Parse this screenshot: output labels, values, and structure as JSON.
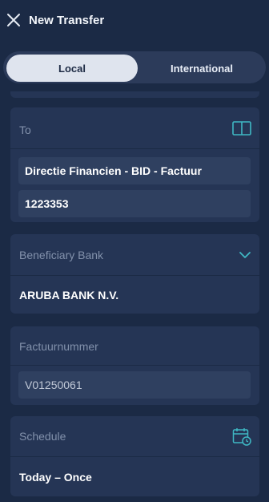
{
  "header": {
    "title": "New Transfer",
    "close_icon": "close-icon"
  },
  "transfer_type": {
    "tabs": [
      {
        "label": "Local",
        "selected": true
      },
      {
        "label": "International",
        "selected": false
      }
    ]
  },
  "to": {
    "label": "To",
    "icon": "address-book-icon",
    "name": "Directie Financien - BID - Factuur",
    "account": "1223353"
  },
  "bank": {
    "label": "Beneficiary Bank",
    "icon": "chevron-down-icon",
    "value": "ARUBA BANK N.V."
  },
  "invoice": {
    "label": "Factuurnummer",
    "value": "V01250061"
  },
  "schedule": {
    "label": "Schedule",
    "icon": "calendar-clock-icon",
    "value": "Today – Once"
  },
  "colors": {
    "background": "#1b2a45",
    "card": "#253555",
    "accent": "#3fb8c4"
  }
}
